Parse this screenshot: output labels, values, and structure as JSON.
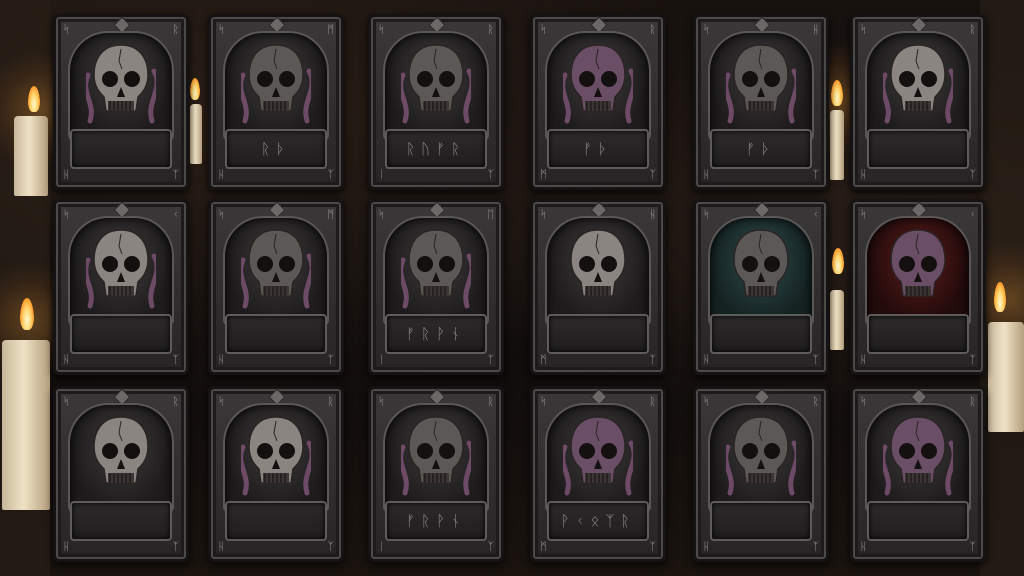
{
  "colors": {
    "skull_bone": "#8a8580",
    "skull_purple": "#6a4e66",
    "tentacle": "#6d4a66",
    "frame": "#3a3838",
    "candle_flame": "#ffd46a"
  },
  "cards": [
    {
      "row": 0,
      "col": 0,
      "skull": "bone",
      "tentacles": true,
      "plate_text": "",
      "corners": [
        "ᛋ",
        "ᚱ",
        "ᚺ",
        "ᛉ"
      ]
    },
    {
      "row": 0,
      "col": 1,
      "skull": "dark",
      "tentacles": true,
      "plate_text": "ᚱᚦ",
      "corners": [
        "ᛋ",
        "ᛗ",
        "ᚺ",
        "ᛉ"
      ]
    },
    {
      "row": 0,
      "col": 2,
      "skull": "dark",
      "tentacles": true,
      "plate_text": "ᚱᚢᚠᚱ",
      "corners": [
        "ᛋ",
        "ᚱ",
        "ᛁ",
        "ᛉ"
      ]
    },
    {
      "row": 0,
      "col": 3,
      "skull": "purple",
      "tentacles": true,
      "plate_text": "ᚠᚦ",
      "corners": [
        "ᛋ",
        "ᚱ",
        "ᛗ",
        "ᛉ"
      ]
    },
    {
      "row": 0,
      "col": 4,
      "skull": "dark",
      "tentacles": true,
      "plate_text": "ᚠᚦ",
      "corners": [
        "ᛋ",
        "ᚺ",
        "ᚺ",
        "ᛉ"
      ]
    },
    {
      "row": 0,
      "col": 5,
      "skull": "bone",
      "tentacles": true,
      "plate_text": "",
      "corners": [
        "ᛋ",
        "ᚱ",
        "ᚺ",
        "ᛉ"
      ]
    },
    {
      "row": 1,
      "col": 0,
      "skull": "bone",
      "tentacles": true,
      "plate_text": "",
      "corners": [
        "ᛋ",
        "ᚲ",
        "ᚺ",
        "ᛉ"
      ]
    },
    {
      "row": 1,
      "col": 1,
      "skull": "dark",
      "tentacles": true,
      "plate_text": "",
      "corners": [
        "ᛋ",
        "ᛗ",
        "ᚺ",
        "ᛉ"
      ]
    },
    {
      "row": 1,
      "col": 2,
      "skull": "dark",
      "tentacles": true,
      "plate_text": "ᚠᚱᚹᚾ",
      "corners": [
        "ᛋ",
        "ᛖ",
        "ᛁ",
        "ᛉ"
      ]
    },
    {
      "row": 1,
      "col": 3,
      "skull": "bone",
      "tentacles": false,
      "plate_text": "",
      "corners": [
        "ᛋ",
        "ᚺ",
        "ᛗ",
        "ᛉ"
      ]
    },
    {
      "row": 1,
      "col": 4,
      "skull": "dark",
      "tentacles": false,
      "plate_text": "",
      "corners": [
        "ᛋ",
        "ᚲ",
        "ᚺ",
        "ᛉ"
      ],
      "bg": "teal"
    },
    {
      "row": 1,
      "col": 5,
      "skull": "purple",
      "tentacles": false,
      "plate_text": "",
      "corners": [
        "ᛋ",
        "ᚲ",
        "ᚺ",
        "ᛉ"
      ],
      "bg": "red"
    },
    {
      "row": 2,
      "col": 0,
      "skull": "bone",
      "tentacles": false,
      "plate_text": "",
      "corners": [
        "ᛋ",
        "ᚱ",
        "ᚺ",
        "ᛉ"
      ]
    },
    {
      "row": 2,
      "col": 1,
      "skull": "bone",
      "tentacles": true,
      "plate_text": "",
      "corners": [
        "ᛋ",
        "ᚱ",
        "ᚺ",
        "ᛉ"
      ]
    },
    {
      "row": 2,
      "col": 2,
      "skull": "dark",
      "tentacles": true,
      "plate_text": "ᚠᚱᚹᚾ",
      "corners": [
        "ᛋ",
        "ᚱ",
        "ᛁ",
        "ᛉ"
      ]
    },
    {
      "row": 2,
      "col": 3,
      "skull": "purple",
      "tentacles": true,
      "plate_text": "ᚹᚲᛟᛉᚱ",
      "corners": [
        "ᛋ",
        "ᚱ",
        "ᛗ",
        "ᛉ"
      ]
    },
    {
      "row": 2,
      "col": 4,
      "skull": "dark",
      "tentacles": true,
      "plate_text": "",
      "corners": [
        "ᛋ",
        "ᚱ",
        "ᚺ",
        "ᛉ"
      ]
    },
    {
      "row": 2,
      "col": 5,
      "skull": "purple",
      "tentacles": true,
      "plate_text": "",
      "corners": [
        "ᛋ",
        "ᚱ",
        "ᚺ",
        "ᛉ"
      ]
    }
  ]
}
